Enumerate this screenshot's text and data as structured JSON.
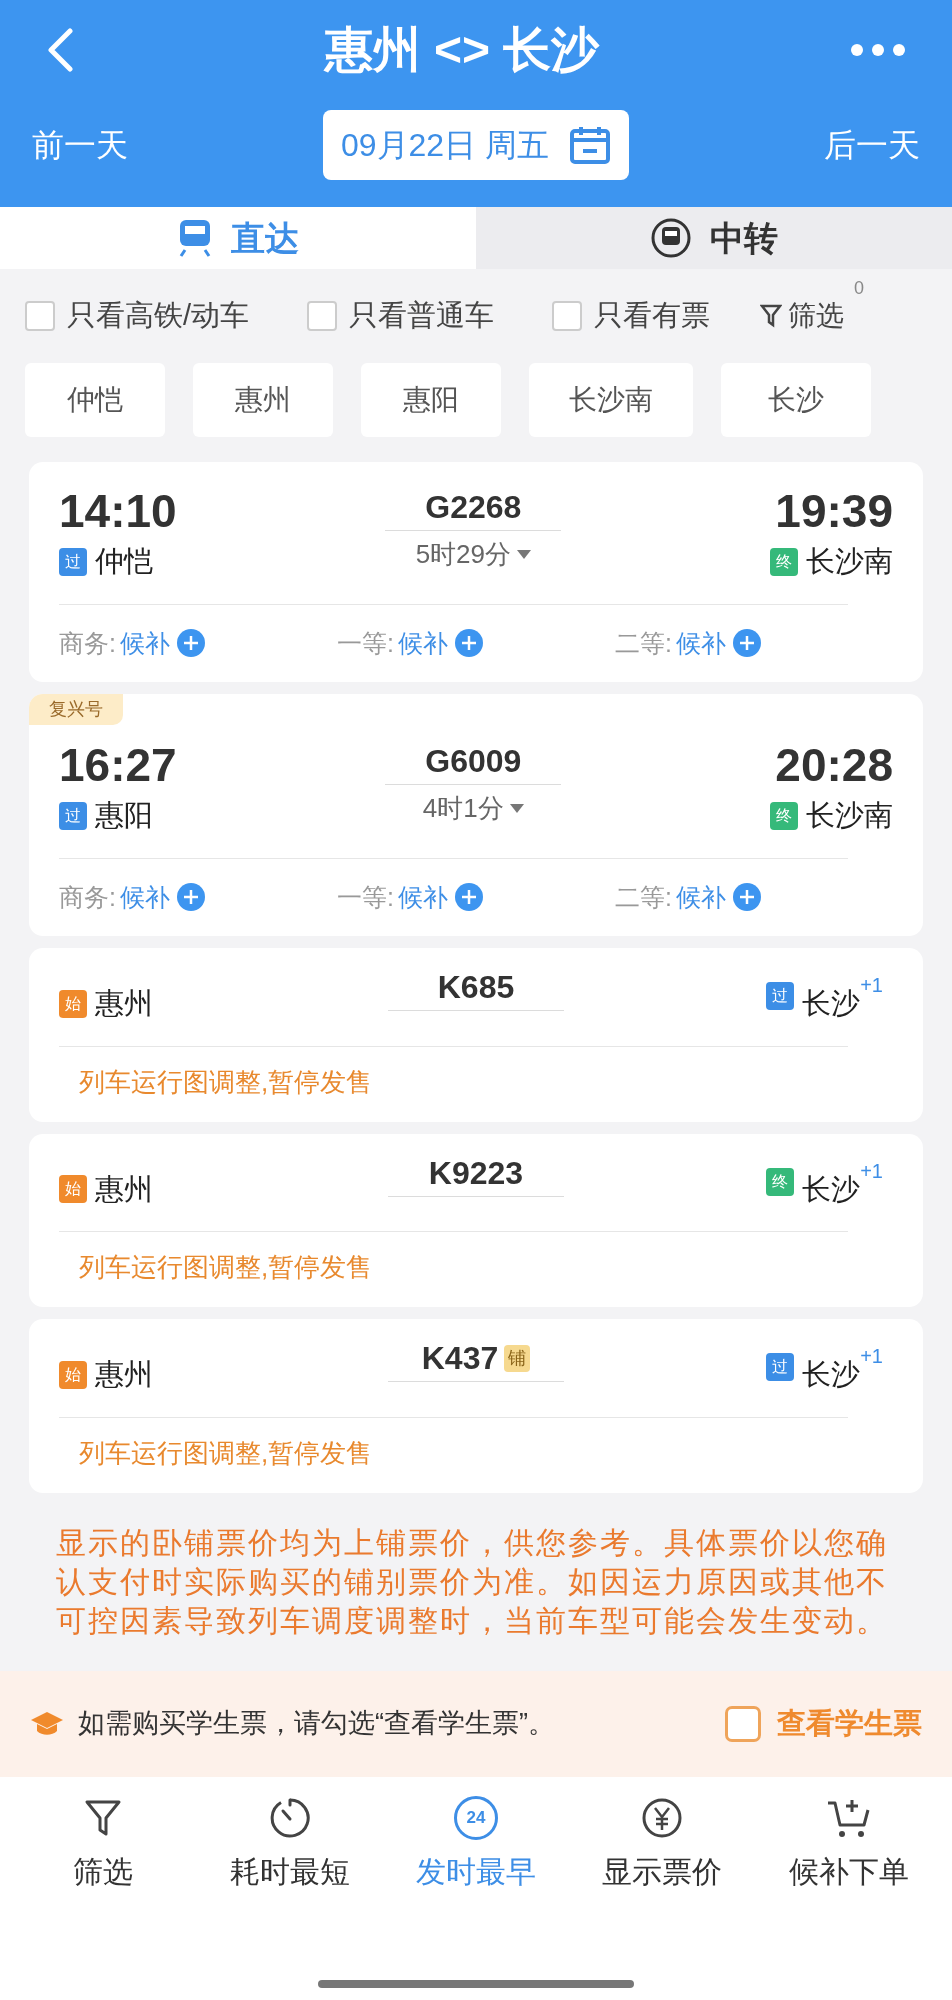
{
  "header": {
    "title": "惠州 <> 长沙",
    "prev_day": "前一天",
    "date": "09月22日 周五",
    "next_day": "后一天"
  },
  "tabs": [
    {
      "label": "直达",
      "selected": true
    },
    {
      "label": "中转",
      "selected": false
    }
  ],
  "filters": [
    {
      "label": "只看高铁/动车",
      "checked": false
    },
    {
      "label": "只看普通车",
      "checked": false
    },
    {
      "label": "只看有票",
      "checked": false
    }
  ],
  "filter_button": {
    "label": "筛选",
    "count": "0"
  },
  "stations": [
    {
      "label": "仲恺",
      "selected": false
    },
    {
      "label": "惠州",
      "selected": false
    },
    {
      "label": "惠阳",
      "selected": false
    },
    {
      "label": "长沙南",
      "selected": false
    },
    {
      "label": "长沙",
      "selected": false
    }
  ],
  "trains": [
    {
      "kind": "bookable",
      "number": "G2268",
      "depart_time": "14:10",
      "arrive_time": "19:39",
      "duration": "5时29分",
      "from": {
        "badge": "过",
        "color": "#3c8ee6",
        "name": "仲恺"
      },
      "to": {
        "badge": "终",
        "color": "#35b97a",
        "name": "长沙南"
      },
      "seats": [
        {
          "label": "商务:",
          "status": "候补"
        },
        {
          "label": "一等:",
          "status": "候补"
        },
        {
          "label": "二等:",
          "status": "候补"
        }
      ]
    },
    {
      "kind": "bookable",
      "tag": "复兴号",
      "number": "G6009",
      "depart_time": "16:27",
      "arrive_time": "20:28",
      "duration": "4时1分",
      "from": {
        "badge": "过",
        "color": "#3c8ee6",
        "name": "惠阳"
      },
      "to": {
        "badge": "终",
        "color": "#35b97a",
        "name": "长沙南"
      },
      "seats": [
        {
          "label": "商务:",
          "status": "候补"
        },
        {
          "label": "一等:",
          "status": "候补"
        },
        {
          "label": "二等:",
          "status": "候补"
        }
      ]
    },
    {
      "kind": "suspended",
      "number": "K685",
      "from": {
        "badge": "始",
        "color": "#f08a2c",
        "name": "惠州"
      },
      "to": {
        "badge": "过",
        "color": "#3c8ee6",
        "name": "长沙"
      },
      "day_offset": "+1",
      "notice": "列车运行图调整,暂停发售"
    },
    {
      "kind": "suspended",
      "number": "K9223",
      "from": {
        "badge": "始",
        "color": "#f08a2c",
        "name": "惠州"
      },
      "to": {
        "badge": "终",
        "color": "#35b97a",
        "name": "长沙"
      },
      "day_offset": "+1",
      "notice": "列车运行图调整,暂停发售"
    },
    {
      "kind": "suspended",
      "number": "K437",
      "sleeper_badge": "铺",
      "from": {
        "badge": "始",
        "color": "#f08a2c",
        "name": "惠州"
      },
      "to": {
        "badge": "过",
        "color": "#3c8ee6",
        "name": "长沙"
      },
      "day_offset": "+1",
      "notice": "列车运行图调整,暂停发售"
    }
  ],
  "disclaimer": "显示的卧铺票价均为上铺票价，供您参考。具体票价以您确认支付时实际购买的铺别票价为准。如因运力原因或其他不可控因素导致列车调度调整时，当前车型可能会发生变动。",
  "student_banner": {
    "text": "如需购买学生票，请勾选“查看学生票”。",
    "checkbox_label": "查看学生票",
    "checked": false
  },
  "bottom_nav": [
    {
      "kind": "filter",
      "label": "筛选",
      "selected": false
    },
    {
      "kind": "timer",
      "label": "耗时最短",
      "selected": false
    },
    {
      "kind": "clock24",
      "label": "发时最早",
      "selected": true,
      "icon_text": "24"
    },
    {
      "kind": "price",
      "label": "显示票价",
      "selected": false
    },
    {
      "kind": "cart",
      "label": "候补下单",
      "selected": false
    }
  ]
}
